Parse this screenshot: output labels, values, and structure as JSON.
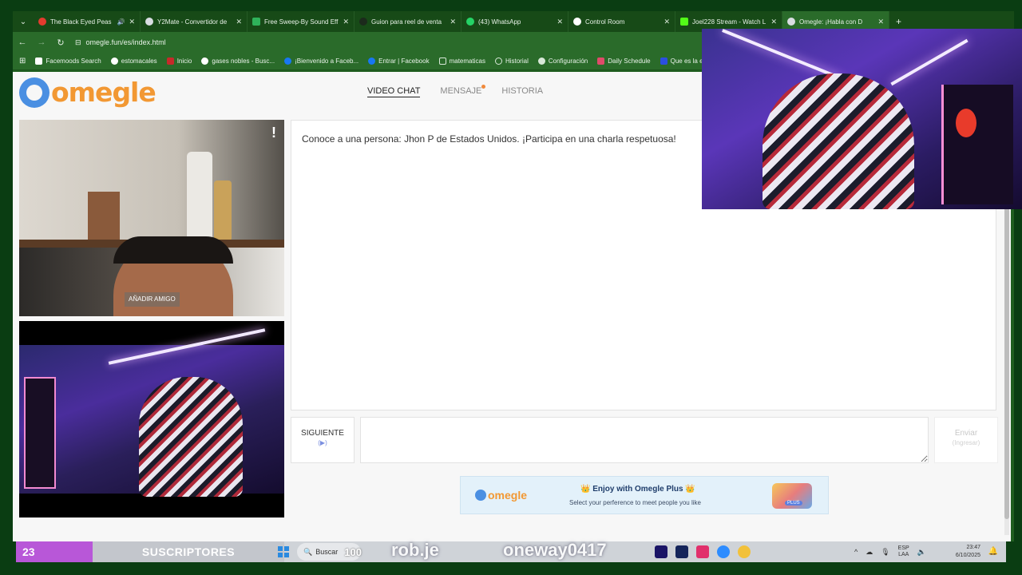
{
  "browser": {
    "tabs": [
      {
        "title": "The Black Eyed Peas",
        "color": "#e33b2e"
      },
      {
        "title": "Y2Mate - Convertidor de",
        "color": "#d9dde2"
      },
      {
        "title": "Free Sweep-By Sound Eff",
        "color": "#2fb25a"
      },
      {
        "title": "Guion para reel de venta",
        "color": "#1c2a1c"
      },
      {
        "title": "(43) WhatsApp",
        "color": "#25d366"
      },
      {
        "title": "Control Room",
        "color": "#ffffff"
      },
      {
        "title": "Joel228 Stream - Watch L",
        "color": "#53fc18"
      },
      {
        "title": "Omegle: ¡Habla con D",
        "color": "#d9dde2"
      }
    ],
    "url": "omegle.fun/es/index.html",
    "bookmarks": [
      {
        "label": "Facemoods Search",
        "color": "#ffffff"
      },
      {
        "label": "estomacales",
        "color": "#ffffff"
      },
      {
        "label": "Inicio",
        "color": "#c72a2a"
      },
      {
        "label": "gases nobles - Busc...",
        "color": "#ffffff"
      },
      {
        "label": "¡Bienvenido a Faceb...",
        "color": "#1877f2"
      },
      {
        "label": "Entrar | Facebook",
        "color": "#1877f2"
      },
      {
        "label": "matematicas",
        "color": "#d8e8d8"
      },
      {
        "label": "Historial",
        "color": "#d8e8d8"
      },
      {
        "label": "Configuración",
        "color": "#d8e8d8"
      },
      {
        "label": "Daily Schedule",
        "color": "#e04b6a"
      },
      {
        "label": "Que es la escali",
        "color": "#2b4fe0"
      }
    ]
  },
  "site": {
    "logo_text": "omegle",
    "nav": {
      "video_chat": "VIDEO CHAT",
      "message": "MENSAJE",
      "history": "HISTORIA"
    }
  },
  "video": {
    "add_friend": "AÑADIR AMIGO",
    "report": "!"
  },
  "chat": {
    "message": "Conoce a una persona: Jhon P de Estados Unidos. ¡Participa en una charla respetuosa!",
    "next_label": "SIGUIENTE",
    "next_hint": "(▶)",
    "send_label": "Enviar",
    "send_hint": "(Ingresar)",
    "input_value": ""
  },
  "banner": {
    "logo_text": "omegle",
    "title": "👑 Enjoy with Omegle Plus 👑",
    "subtitle": "Select your perference to meet people you like",
    "badge": "PLUS"
  },
  "stream_overlay": {
    "subscriber_count": "23",
    "subscriber_label": "SUSCRIPTORES",
    "search_placeholder": "Buscar",
    "search_number": "100",
    "handle_1": "rob.je",
    "handle_2": "oneway0417"
  },
  "taskbar": {
    "lang_top": "ESP",
    "lang_bottom": "LAA",
    "time": "23:47",
    "date": "6/10/2025"
  },
  "colors": {
    "accent_orange": "#f29833",
    "accent_blue": "#4a8fe2",
    "subscriber_purple": "#b857d8"
  }
}
